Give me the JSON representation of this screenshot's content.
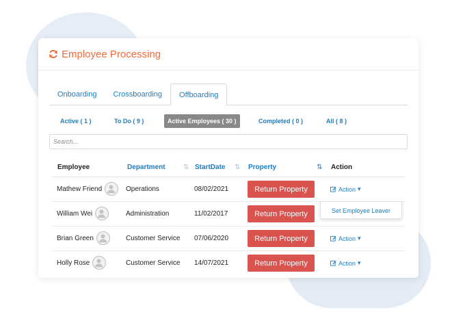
{
  "header": {
    "title": "Employee Processing",
    "icon": "refresh-icon",
    "accent": "#f26b3a"
  },
  "tabs": [
    {
      "label": "Onboarding",
      "active": false
    },
    {
      "label": "Crossboarding",
      "active": false
    },
    {
      "label": "Offboarding",
      "active": true
    }
  ],
  "filters": [
    {
      "label": "Active ( 1 )",
      "selected": false
    },
    {
      "label": "To Do ( 9 )",
      "selected": false
    },
    {
      "label": "Active Employees ( 30 )",
      "selected": true
    },
    {
      "label": "Completed ( 0 )",
      "selected": false
    },
    {
      "label": "All ( 8 )",
      "selected": false
    }
  ],
  "search": {
    "placeholder": "Search..."
  },
  "table": {
    "columns": [
      "Employee",
      "Department",
      "StartDate",
      "Property",
      "Action"
    ],
    "rows": [
      {
        "employee": "Mathew Friend",
        "department": "Operations",
        "start_date": "08/02/2021",
        "property": "Return Property",
        "action": "Action"
      },
      {
        "employee": "William Wei",
        "department": "Administration",
        "start_date": "11/02/2017",
        "property": "Return Property",
        "action": ""
      },
      {
        "employee": "Brian Green",
        "department": "Customer Service",
        "start_date": "07/06/2020",
        "property": "Return Property",
        "action": "Action"
      },
      {
        "employee": "Holly Rose",
        "department": "Customer Service",
        "start_date": "14/07/2021",
        "property": "Return Property",
        "action": "Action"
      }
    ]
  },
  "dropdown": {
    "item": "Set Employee Leaver"
  },
  "colors": {
    "link": "#1e7dc1",
    "danger": "#d9534f",
    "pill": "#888888"
  }
}
